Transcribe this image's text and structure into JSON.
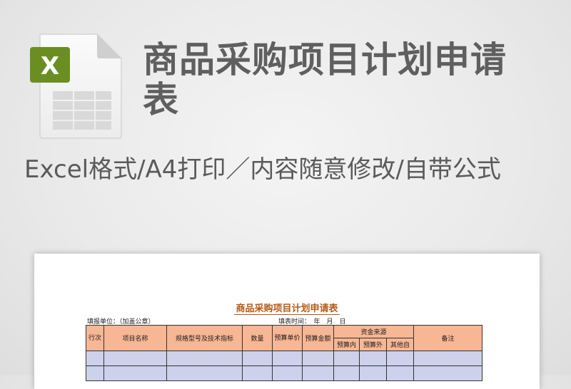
{
  "header": {
    "title": "商品采购项目计划申请表",
    "subtitle": "Excel格式/A4打印／内容随意修改/自带公式"
  },
  "icon": {
    "name": "excel-file-icon",
    "badge_letter": "X",
    "badge_color": "#6b8e23"
  },
  "document": {
    "title": "商品采购项目计划申请表",
    "unit_label": "填报单位：（加盖公章）",
    "date_label": "填表时间：　年　月　日",
    "columns": {
      "row_no": "行次",
      "item_name": "项目名称",
      "spec": "规格型号及技术指标",
      "quantity": "数量",
      "unit_budget": "预算单价",
      "budget_amount": "预算金额",
      "fund_source": "资金来源",
      "fund_inside": "预算内",
      "fund_outside": "预算外",
      "fund_own": "其他自",
      "remarks": "备注"
    },
    "colors": {
      "header_fill": "#f7b694",
      "row_fill": "#ccd2eb",
      "title_color": "#b65a14"
    }
  }
}
